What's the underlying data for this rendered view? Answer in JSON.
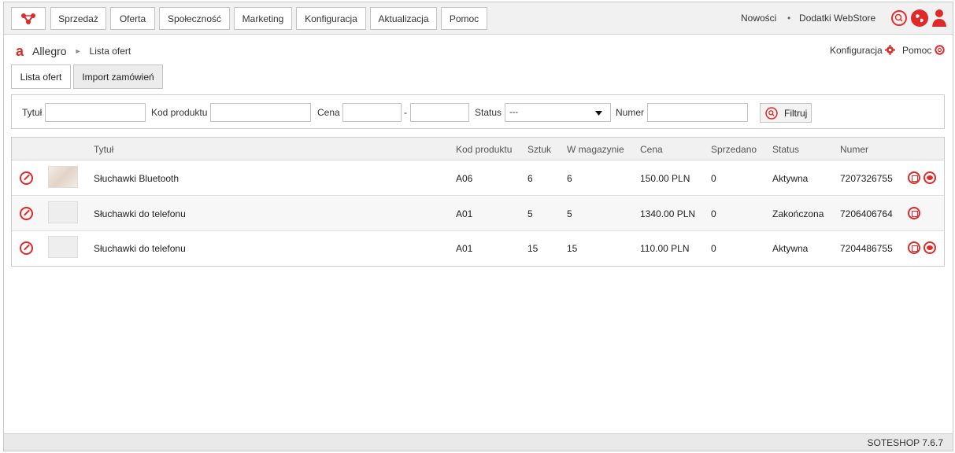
{
  "nav": {
    "items": [
      "Sprzedaż",
      "Oferta",
      "Społeczność",
      "Marketing",
      "Konfiguracja",
      "Aktualizacja",
      "Pomoc"
    ],
    "right_links": [
      "Nowości",
      "Dodatki WebStore"
    ],
    "separator": "•"
  },
  "breadcrumb": {
    "brand": "Allegro",
    "separator": "►",
    "page": "Lista ofert",
    "config_link": "Konfiguracja",
    "help_link": "Pomoc"
  },
  "tabs": [
    "Lista ofert",
    "Import zamówień"
  ],
  "filter": {
    "title_label": "Tytuł",
    "title_value": "",
    "code_label": "Kod produktu",
    "code_value": "",
    "price_label": "Cena",
    "price_from": "",
    "price_dash": "-",
    "price_to": "",
    "status_label": "Status",
    "status_value": "---",
    "number_label": "Numer",
    "number_value": "",
    "button_label": "Filtruj"
  },
  "table": {
    "headers": [
      "Tytuł",
      "Kod produktu",
      "Sztuk",
      "W magazynie",
      "Cena",
      "Sprzedano",
      "Status",
      "Numer"
    ],
    "rows": [
      {
        "title": "Słuchawki Bluetooth",
        "code": "A06",
        "qty": "6",
        "stock": "6",
        "price": "150.00 PLN",
        "sold": "0",
        "status": "Aktywna",
        "number": "7207326755",
        "has_view": true
      },
      {
        "title": "Słuchawki do telefonu",
        "code": "A01",
        "qty": "5",
        "stock": "5",
        "price": "1340.00 PLN",
        "sold": "0",
        "status": "Zakończona",
        "number": "7206406764",
        "has_view": false
      },
      {
        "title": "Słuchawki do telefonu",
        "code": "A01",
        "qty": "15",
        "stock": "15",
        "price": "110.00 PLN",
        "sold": "0",
        "status": "Aktywna",
        "number": "7204486755",
        "has_view": true
      }
    ]
  },
  "footer": {
    "version": "SOTESHOP 7.6.7"
  },
  "colors": {
    "accent": "#e02a2a",
    "topbar": "#f1f1f1"
  },
  "icons": [
    "logo-icon",
    "search-icon",
    "globe-icon",
    "user-icon",
    "allegro-logo-icon",
    "gear-icon",
    "lifebuoy-icon",
    "edit-icon",
    "copy-icon",
    "view-icon",
    "chevron-down-icon"
  ]
}
